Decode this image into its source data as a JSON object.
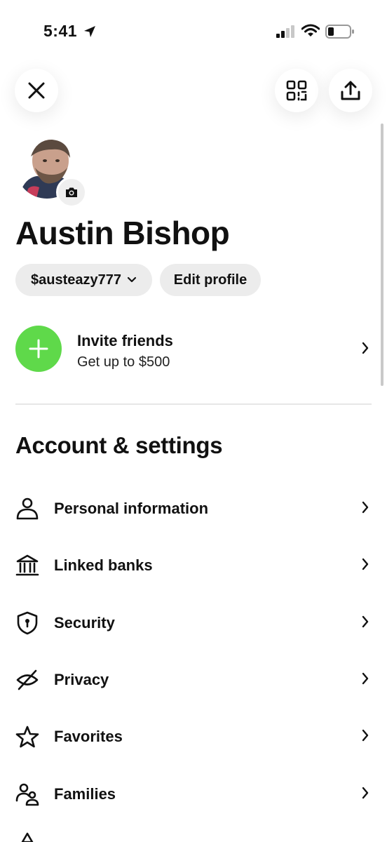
{
  "status_bar": {
    "time": "5:41"
  },
  "profile": {
    "name": "Austin Bishop",
    "cashtag": "$austeazy777",
    "edit_label": "Edit profile"
  },
  "invite": {
    "title": "Invite friends",
    "subtitle": "Get up to $500",
    "accent_color": "#5fd94a"
  },
  "settings": {
    "section_title": "Account & settings",
    "items": [
      {
        "label": "Personal information",
        "icon": "person-icon"
      },
      {
        "label": "Linked banks",
        "icon": "bank-icon"
      },
      {
        "label": "Security",
        "icon": "shield-icon"
      },
      {
        "label": "Privacy",
        "icon": "eye-off-icon"
      },
      {
        "label": "Favorites",
        "icon": "star-icon"
      },
      {
        "label": "Families",
        "icon": "family-icon"
      }
    ]
  }
}
